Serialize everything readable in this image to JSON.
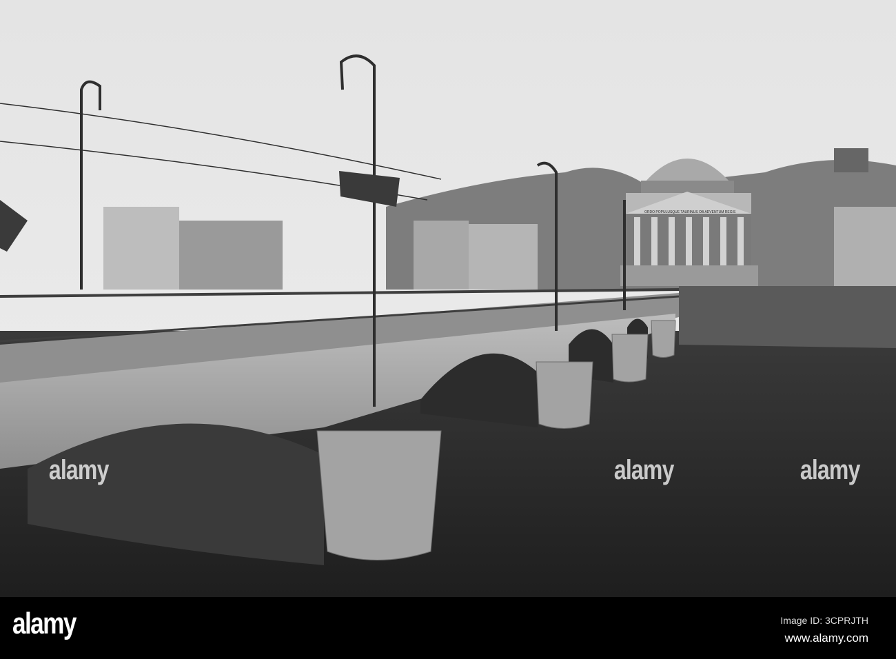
{
  "photo": {
    "subject": "Black and white view of stone arch bridge over river with domed church"
  },
  "church_inscription": "ORDO POPULUSQUE TAURINUS OB ADVENTUM REGIS",
  "watermark": "alamy",
  "footer": {
    "logo": "alamy",
    "image_id": "Image ID: 3CPRJTH",
    "url": "www.alamy.com"
  }
}
